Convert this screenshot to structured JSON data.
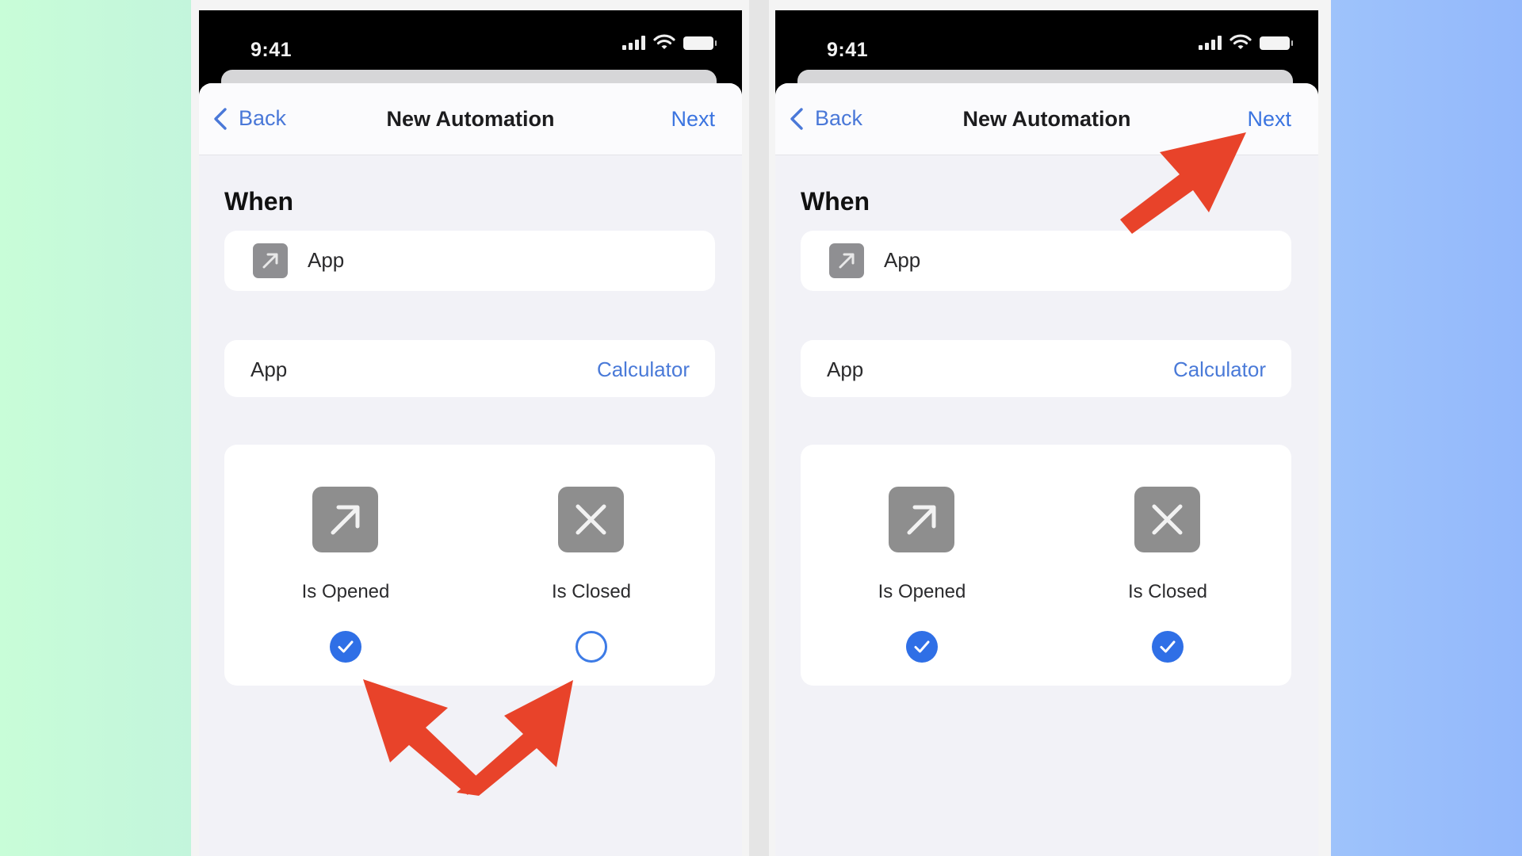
{
  "colors": {
    "accent_blue": "#3b74e0",
    "checkbox_blue": "#2f6fe6",
    "annotation_red": "#e8432a",
    "icon_gray": "#8e8e8e",
    "screen_bg": "#f2f2f7"
  },
  "phones": [
    {
      "status_bar": {
        "time": "9:41",
        "icons": [
          "cellular-signal-icon",
          "wifi-icon",
          "battery-icon"
        ]
      },
      "nav": {
        "back_label": "Back",
        "title": "New Automation",
        "next_label": "Next"
      },
      "section_title": "When",
      "trigger": {
        "icon": "app-open-arrow-icon",
        "label": "App"
      },
      "app_row": {
        "label": "App",
        "value": "Calculator"
      },
      "options": [
        {
          "icon": "arrow-up-right-icon",
          "label": "Is Opened",
          "checked": true
        },
        {
          "icon": "x-mark-icon",
          "label": "Is Closed",
          "checked": false
        }
      ],
      "annotation": "arrows pointing to both checkboxes"
    },
    {
      "status_bar": {
        "time": "9:41",
        "icons": [
          "cellular-signal-icon",
          "wifi-icon",
          "battery-icon"
        ]
      },
      "nav": {
        "back_label": "Back",
        "title": "New Automation",
        "next_label": "Next"
      },
      "section_title": "When",
      "trigger": {
        "icon": "app-open-arrow-icon",
        "label": "App"
      },
      "app_row": {
        "label": "App",
        "value": "Calculator"
      },
      "options": [
        {
          "icon": "arrow-up-right-icon",
          "label": "Is Opened",
          "checked": true
        },
        {
          "icon": "x-mark-icon",
          "label": "Is Closed",
          "checked": true
        }
      ],
      "annotation": "arrow pointing to Next button"
    }
  ]
}
